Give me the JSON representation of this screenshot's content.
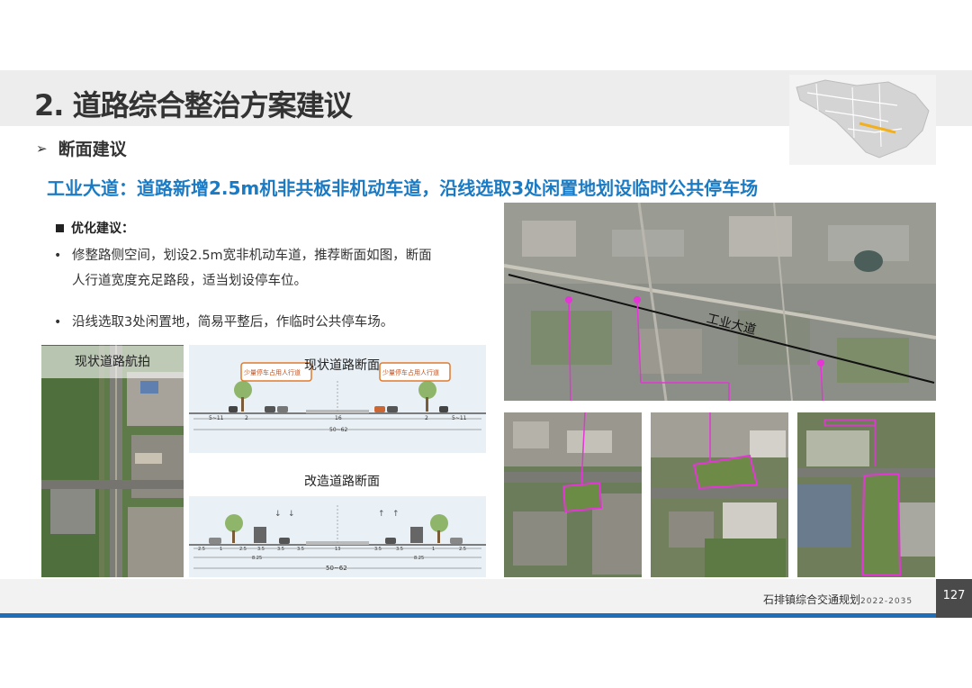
{
  "title": "2. 道路综合整治方案建议",
  "section": {
    "arrow": "➢",
    "heading": "断面建议"
  },
  "headline": "工业大道：道路新增2.5m机非共板非机动车道，沿线选取3处闲置地划设临时公共停车场",
  "advice": {
    "heading": "优化建议：",
    "bullets": [
      {
        "line1": "修整路侧空间，划设2.5m宽非机动车道，推荐断面如图，断面",
        "line2": "人行道宽度充足路段，适当划设停车位。"
      },
      {
        "line1": "沿线选取3处闲置地，简易平整后，作临时公共停车场。"
      }
    ]
  },
  "aerial_label": "现状道路航拍",
  "current_section": {
    "title": "现状道路断面",
    "callout_left": "少量停车占用人行道",
    "callout_right": "少量停车占用人行道",
    "dims_top": [
      "5~11",
      "2",
      "16",
      "2",
      "5~11"
    ],
    "dims_bottom": "50~62"
  },
  "improved_section": {
    "title": "改造道路断面",
    "dims_top": [
      "2.5",
      "1",
      "2.5",
      "3.5",
      "3.5",
      "3.5",
      "13",
      "3.5",
      "3.5",
      "1",
      "2.5"
    ],
    "dims_mid": [
      "8.25",
      "8.25"
    ],
    "dims_bottom": "50~62"
  },
  "map": {
    "road_label": "工业大道"
  },
  "footer": {
    "plan_name": "石排镇综合交通规划",
    "years": "2022-2035",
    "page": "127"
  },
  "colors": {
    "accent": "#1a7bc4",
    "magenta": "#e535d6",
    "footer_line": "#1f6fb8"
  }
}
